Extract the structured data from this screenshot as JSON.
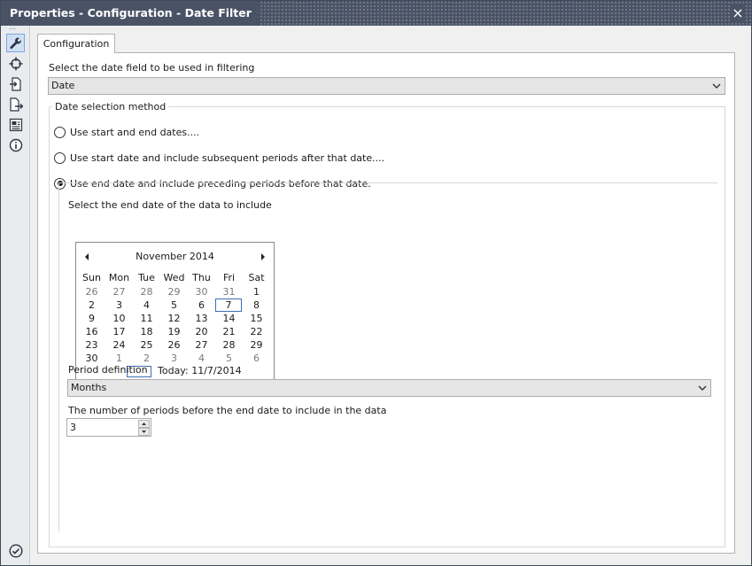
{
  "window": {
    "title": "Properties - Configuration - Date Filter",
    "close_glyph": "×"
  },
  "toolstrip": {
    "items": [
      {
        "icon": "wrench-icon",
        "active": true
      },
      {
        "icon": "crosshair-icon"
      },
      {
        "icon": "input-file-icon"
      },
      {
        "icon": "output-file-icon"
      },
      {
        "icon": "annotation-icon"
      },
      {
        "icon": "info-icon"
      }
    ],
    "bottom_icon": "check-circle-icon"
  },
  "tabs": [
    {
      "label": "Configuration",
      "active": true
    }
  ],
  "field_select": {
    "label": "Select the date field to be used in filtering",
    "value": "Date"
  },
  "method_group": {
    "legend": "Date selection method",
    "options": [
      {
        "label": "Use start and end dates....",
        "checked": false
      },
      {
        "label": "Use start date and include subsequent periods after that date....",
        "checked": false
      },
      {
        "label": "Use end date and include preceding periods before that date.",
        "checked": true
      }
    ]
  },
  "end_date": {
    "label": "Select the end date of the data to include",
    "calendar": {
      "month_label": "November 2014",
      "weekdays": [
        "Sun",
        "Mon",
        "Tue",
        "Wed",
        "Thu",
        "Fri",
        "Sat"
      ],
      "weeks": [
        [
          "26",
          "27",
          "28",
          "29",
          "30",
          "31",
          "1"
        ],
        [
          "2",
          "3",
          "4",
          "5",
          "6",
          "7",
          "8"
        ],
        [
          "9",
          "10",
          "11",
          "12",
          "13",
          "14",
          "15"
        ],
        [
          "16",
          "17",
          "18",
          "19",
          "20",
          "21",
          "22"
        ],
        [
          "23",
          "24",
          "25",
          "26",
          "27",
          "28",
          "29"
        ],
        [
          "30",
          "1",
          "2",
          "3",
          "4",
          "5",
          "6"
        ]
      ],
      "selected_day": "7",
      "today_label": "Today: 11/7/2014"
    }
  },
  "period": {
    "label": "Period definition",
    "value": "Months"
  },
  "count": {
    "label": "The number of periods before the end date to include in the data",
    "value": "3"
  },
  "colors": {
    "titlebar": "#4a5366",
    "selection": "#3b70b5"
  }
}
